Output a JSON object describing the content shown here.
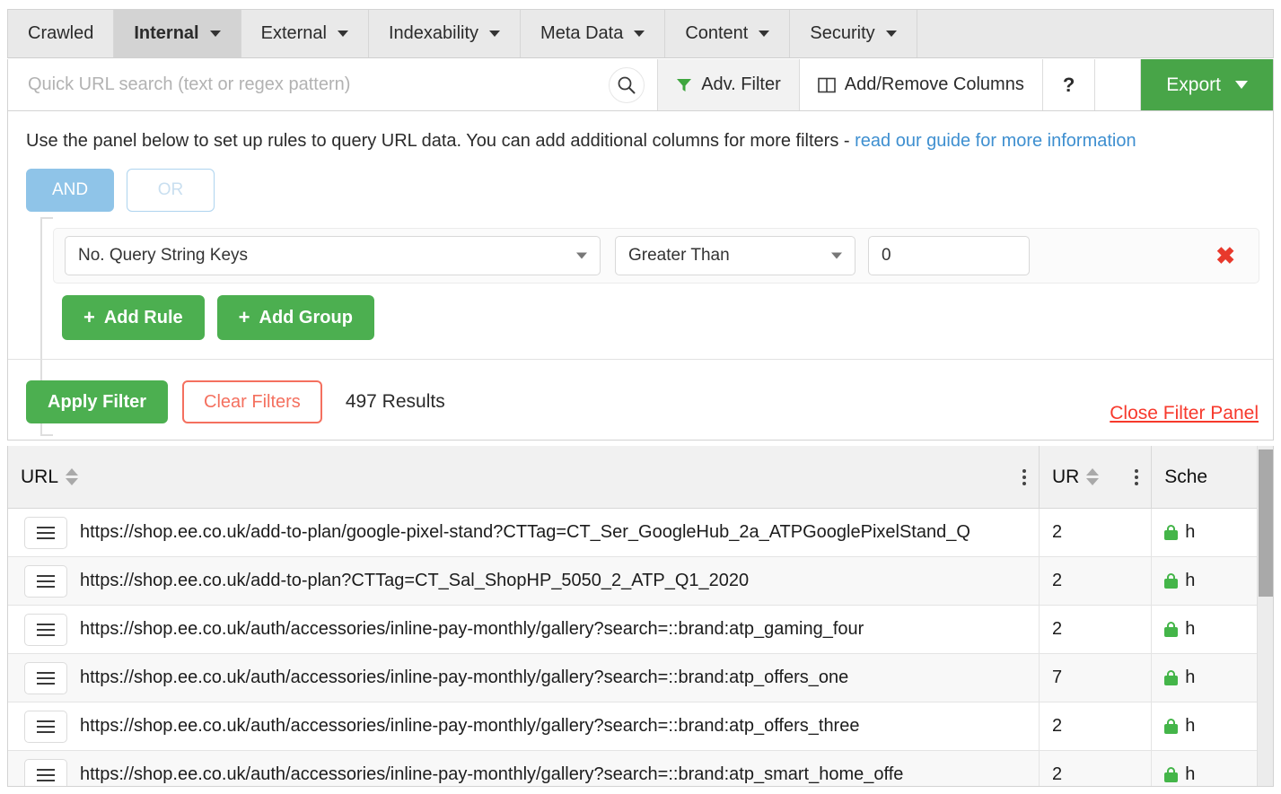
{
  "tabs": [
    {
      "label": "Crawled",
      "has_caret": false,
      "active": false
    },
    {
      "label": "Internal",
      "has_caret": true,
      "active": true
    },
    {
      "label": "External",
      "has_caret": true,
      "active": false
    },
    {
      "label": "Indexability",
      "has_caret": true,
      "active": false
    },
    {
      "label": "Meta Data",
      "has_caret": true,
      "active": false
    },
    {
      "label": "Content",
      "has_caret": true,
      "active": false
    },
    {
      "label": "Security",
      "has_caret": true,
      "active": false
    }
  ],
  "toolbar": {
    "search_placeholder": "Quick URL search (text or regex pattern)",
    "search_value": "",
    "search_icon": "search-icon",
    "adv_filter_label": "Adv. Filter",
    "adv_filter_icon": "funnel-icon",
    "add_remove_columns_label": "Add/Remove Columns",
    "add_remove_columns_icon": "columns-icon",
    "help_label": "?",
    "export_label": "Export",
    "export_caret_icon": "chevron-down-icon"
  },
  "panel": {
    "help_text": "Use the panel below to set up rules to query URL data. You can add additional columns for more filters - ",
    "help_link": "read our guide for more information",
    "and_label": "AND",
    "or_label": "OR",
    "rule": {
      "field": "No. Query String Keys",
      "operator": "Greater Than",
      "value": "0",
      "delete_icon": "close-x-icon"
    },
    "add_rule_label": "Add Rule",
    "add_group_label": "Add Group",
    "plus_glyph": "+",
    "apply_label": "Apply Filter",
    "clear_label": "Clear Filters",
    "results_text": "497 Results",
    "close_panel_label": "Close Filter Panel"
  },
  "table": {
    "columns": [
      {
        "label": "URL",
        "sortable": true,
        "kebab": true
      },
      {
        "label": "UR",
        "sortable": true,
        "kebab": true
      },
      {
        "label": "Sche",
        "sortable": false,
        "kebab": false
      }
    ],
    "rows": [
      {
        "url": "https://shop.ee.co.uk/add-to-plan/google-pixel-stand?CTTag=CT_Ser_GoogleHub_2a_ATPGooglePixelStand_Q",
        "ur": "2",
        "scheme": "h"
      },
      {
        "url": "https://shop.ee.co.uk/add-to-plan?CTTag=CT_Sal_ShopHP_5050_2_ATP_Q1_2020",
        "ur": "2",
        "scheme": "h"
      },
      {
        "url": "https://shop.ee.co.uk/auth/accessories/inline-pay-monthly/gallery?search=::brand:atp_gaming_four",
        "ur": "2",
        "scheme": "h"
      },
      {
        "url": "https://shop.ee.co.uk/auth/accessories/inline-pay-monthly/gallery?search=::brand:atp_offers_one",
        "ur": "7",
        "scheme": "h"
      },
      {
        "url": "https://shop.ee.co.uk/auth/accessories/inline-pay-monthly/gallery?search=::brand:atp_offers_three",
        "ur": "2",
        "scheme": "h"
      },
      {
        "url": "https://shop.ee.co.uk/auth/accessories/inline-pay-monthly/gallery?search=::brand:atp_smart_home_offe",
        "ur": "2",
        "scheme": "h"
      }
    ],
    "row_menu_icon": "hamburger-icon",
    "secure_icon": "lock-icon"
  },
  "colors": {
    "green": "#4caf50",
    "export_green": "#48a548",
    "link_blue": "#3e8fd0",
    "and_blue": "#8fc4e8",
    "clear_red": "#f4705f",
    "close_red": "#f7392c",
    "delete_red": "#e8392c",
    "lock_green": "#44b549"
  }
}
